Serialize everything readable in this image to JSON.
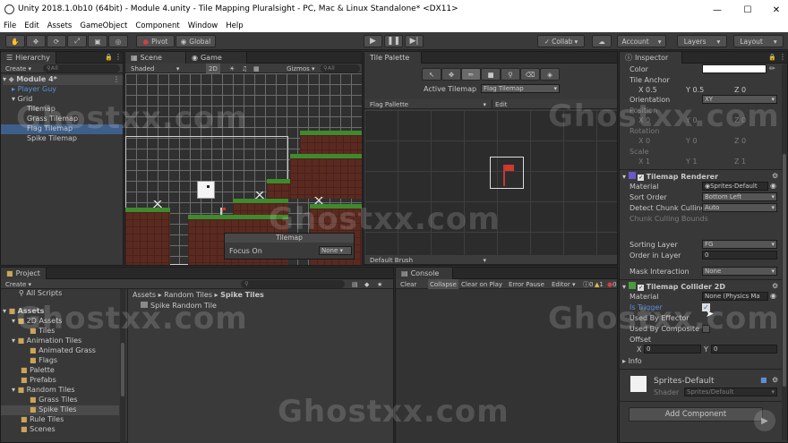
{
  "window": {
    "title": "Unity 2018.1.0b10 (64bit) - Module 4.unity - Tile Mapping Pluralsight - PC, Mac & Linux Standalone* <DX11>"
  },
  "menu": [
    "File",
    "Edit",
    "Assets",
    "GameObject",
    "Component",
    "Window",
    "Help"
  ],
  "toolbar": {
    "pivot": "Pivot",
    "global": "Global",
    "collab": "Collab",
    "account": "Account",
    "layers": "Layers",
    "layout": "Layout"
  },
  "hierarchy": {
    "tab": "Hierarchy",
    "create": "Create",
    "search": "All",
    "items": [
      "Module 4*",
      "Player Guy",
      "Grid",
      "Tilemap",
      "Grass Tilemap",
      "Flag Tilemap",
      "Spike Tilemap"
    ]
  },
  "scene": {
    "tab_scene": "Scene",
    "tab_game": "Game",
    "shaded": "Shaded",
    "mode2d": "2D",
    "gizmos": "Gizmos",
    "search": "All"
  },
  "tilemap_overlay": {
    "title": "Tilemap",
    "focus_label": "Focus On",
    "focus_value": "None"
  },
  "palette": {
    "tab": "Tile Palette",
    "active_label": "Active Tilemap",
    "active_value": "Flag Tilemap",
    "palette_name": "Flag Pallette",
    "edit": "Edit",
    "brush": "Default Brush"
  },
  "project": {
    "tab": "Project",
    "create": "Create",
    "tree": [
      "All Scripts",
      "Assets",
      "2D Assets",
      "Tiles",
      "Animation Tiles",
      "Animated Grass",
      "Flags",
      "Palette",
      "Prefabs",
      "Random Tiles",
      "Grass Tiles",
      "Spike Tiles",
      "Rule Tiles",
      "Scenes"
    ],
    "breadcrumb": [
      "Assets",
      "Random Tiles",
      "Spike Tiles"
    ],
    "file": "Spike Random Tile"
  },
  "console": {
    "tab": "Console",
    "clear": "Clear",
    "collapse": "Collapse",
    "clear_on_play": "Clear on Play",
    "error_pause": "Error Pause",
    "editor": "Editor",
    "count_log": "0",
    "count_warn": "1",
    "count_err": "0"
  },
  "inspector": {
    "tab": "Inspector",
    "color_label": "Color",
    "tile_anchor": "Tile Anchor",
    "anchor": {
      "x": "0.5",
      "y": "0.5",
      "z": "0"
    },
    "orientation_label": "Orientation",
    "orientation_value": "XY",
    "position_label": "Position",
    "rotation_label": "Rotation",
    "scale_label": "Scale",
    "pos": {
      "x": "0",
      "y": "0",
      "z": "0"
    },
    "rot": {
      "x": "0",
      "y": "0",
      "z": "0"
    },
    "scl": {
      "x": "1",
      "y": "1",
      "z": "1"
    },
    "renderer": {
      "title": "Tilemap Renderer",
      "material_label": "Material",
      "material_value": "Sprites-Default",
      "sort_label": "Sort Order",
      "sort_value": "Bottom Left",
      "chunk_label": "Detect Chunk Culling",
      "chunk_value": "Auto",
      "bounds_label": "Chunk Culling Bounds",
      "sorting_layer_label": "Sorting Layer",
      "sorting_layer_value": "FG",
      "order_label": "Order in Layer",
      "order_value": "0",
      "mask_label": "Mask Interaction",
      "mask_value": "None"
    },
    "collider": {
      "title": "Tilemap Collider 2D",
      "material_label": "Material",
      "material_value": "None (Physics Ma",
      "trigger_label": "Is Trigger",
      "effector_label": "Used By Effector",
      "composite_label": "Used By Composite",
      "offset_label": "Offset",
      "offset_x": "0",
      "offset_y": "0",
      "info_label": "Info"
    },
    "material_asset": {
      "name": "Sprites-Default",
      "shader_label": "Shader",
      "shader_value": "Sprites/Default"
    },
    "add_component": "Add Component"
  },
  "watermark": "Ghostxx.com",
  "colors": {
    "accent": "#3e5f8a",
    "blue_text": "#5c8fd6",
    "grass": "#3f8a2c",
    "dirt": "#5a2a20",
    "flag": "#d0392b"
  }
}
